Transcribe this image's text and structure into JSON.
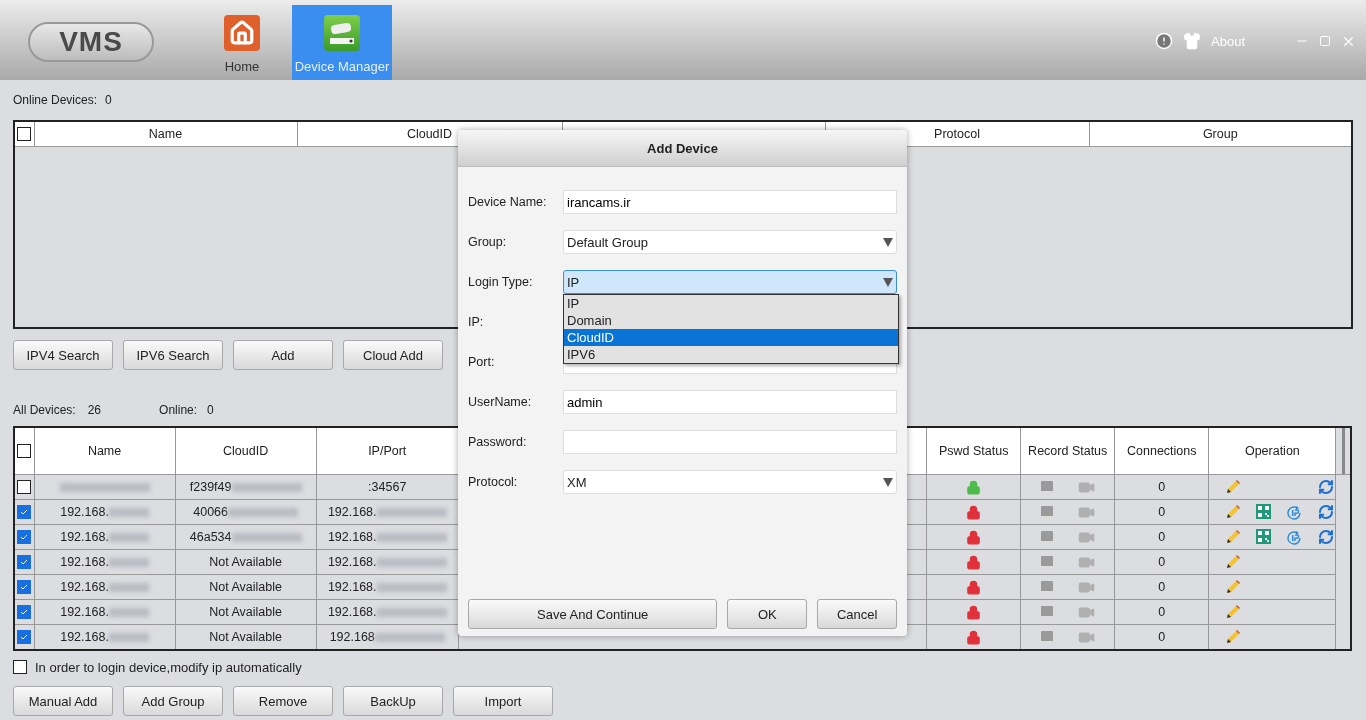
{
  "app": {
    "logo": "VMS",
    "nav": [
      {
        "label": "Home",
        "kind": "home",
        "selected": false
      },
      {
        "label": "Device Manager",
        "kind": "device",
        "selected": true
      }
    ],
    "about": "About"
  },
  "online": {
    "label": "Online Devices:",
    "count": "0",
    "columns": [
      "Name",
      "CloudID",
      "",
      "Protocol",
      "Group"
    ],
    "all_checked": false
  },
  "search_buttons": [
    "IPV4 Search",
    "IPV6 Search",
    "Add",
    "Cloud Add"
  ],
  "summary": {
    "all_label": "All Devices:",
    "all_count": "26",
    "online_label": "Online:",
    "online_count": "0"
  },
  "devices": {
    "columns": [
      "Name",
      "CloudID",
      "IP/Port",
      "",
      "Pswd Status",
      "Record Status",
      "Connections",
      "Operation"
    ],
    "all_checked": false,
    "rows": [
      {
        "checked": false,
        "name": {
          "blurred": true
        },
        "cloud": {
          "text": "f239f49",
          "blurred": true
        },
        "ip": {
          "text": ":34567"
        },
        "pswd_status": {
          "color": "#4cbb4c"
        },
        "connections": "0",
        "actions": [
          {
            "kind": "edit"
          },
          {
            "kind": "refresh"
          }
        ]
      },
      {
        "checked": true,
        "name": {
          "text": "192.168.",
          "blurred": true
        },
        "cloud": {
          "text": "40066",
          "blurred": true
        },
        "ip": {
          "text": "192.168.",
          "blurred": true
        },
        "pswd_status": {
          "color": "#e0303a"
        },
        "connections": "0",
        "actions": [
          {
            "kind": "edit"
          },
          {
            "kind": "qr"
          },
          {
            "kind": "ip"
          },
          {
            "kind": "refresh"
          }
        ]
      },
      {
        "checked": true,
        "name": {
          "text": "192.168.",
          "blurred": true
        },
        "cloud": {
          "text": "46a534",
          "blurred": true
        },
        "ip": {
          "text": "192.168.",
          "blurred": true
        },
        "pswd_status": {
          "color": "#e0303a"
        },
        "connections": "0",
        "actions": [
          {
            "kind": "edit"
          },
          {
            "kind": "qr"
          },
          {
            "kind": "ip"
          },
          {
            "kind": "refresh"
          }
        ]
      },
      {
        "checked": true,
        "name": {
          "text": "192.168.",
          "blurred": true
        },
        "cloud": {
          "text": "Not Available"
        },
        "ip": {
          "text": "192.168.",
          "blurred": true
        },
        "pswd_status": {
          "color": "#e0303a"
        },
        "connections": "0",
        "actions": [
          {
            "kind": "edit"
          }
        ]
      },
      {
        "checked": true,
        "name": {
          "text": "192.168.",
          "blurred": true
        },
        "cloud": {
          "text": "Not Available"
        },
        "ip": {
          "text": "192.168.",
          "blurred": true
        },
        "pswd_status": {
          "color": "#e0303a"
        },
        "connections": "0",
        "actions": [
          {
            "kind": "edit"
          }
        ]
      },
      {
        "checked": true,
        "name": {
          "text": "192.168.",
          "blurred": true
        },
        "cloud": {
          "text": "Not Available"
        },
        "ip": {
          "text": "192.168.",
          "blurred": true
        },
        "pswd_status": {
          "color": "#e0303a"
        },
        "connections": "0",
        "actions": [
          {
            "kind": "edit"
          }
        ]
      },
      {
        "checked": true,
        "name": {
          "text": "192.168.",
          "blurred": true
        },
        "cloud": {
          "text": "Not Available"
        },
        "ip": {
          "text": "192.168",
          "blurred": true
        },
        "pswd_status": {
          "color": "#e0303a"
        },
        "connections": "0",
        "actions": [
          {
            "kind": "edit"
          }
        ]
      }
    ]
  },
  "auto_ip": {
    "label": "In order to login device,modify ip automatically",
    "checked": false
  },
  "bottom_buttons": [
    "Manual Add",
    "Add Group",
    "Remove",
    "BackUp",
    "Import"
  ],
  "dialog": {
    "title": "Add Device",
    "fields": [
      {
        "label": "Device Name:",
        "kind": "text",
        "value": "irancams.ir"
      },
      {
        "label": "Group:",
        "kind": "select",
        "value": "Default Group"
      },
      {
        "label": "Login Type:",
        "kind": "select",
        "value": "IP",
        "open": true,
        "options": [
          {
            "label": "IP",
            "highlighted": false
          },
          {
            "label": "Domain",
            "highlighted": false
          },
          {
            "label": "CloudID",
            "highlighted": true
          },
          {
            "label": "IPV6",
            "highlighted": false
          }
        ]
      },
      {
        "label": "IP:",
        "kind": "text"
      },
      {
        "label": "Port:",
        "kind": "text"
      },
      {
        "label": "UserName:",
        "kind": "text",
        "value": "admin"
      },
      {
        "label": "Password:",
        "kind": "text"
      },
      {
        "label": "Protocol:",
        "kind": "select",
        "value": "XM"
      }
    ],
    "buttons": [
      "Save And Continue",
      "OK",
      "Cancel"
    ]
  }
}
